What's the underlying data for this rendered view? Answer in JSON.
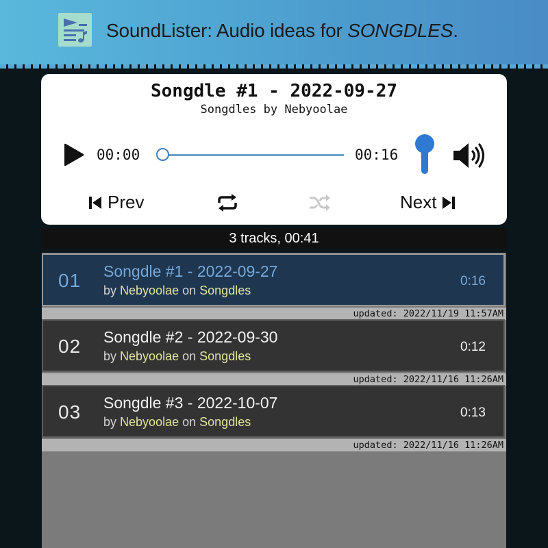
{
  "header": {
    "title_prefix": "SoundLister: Audio ideas for ",
    "title_emphasis": "SONGDLES",
    "title_suffix": ".",
    "logo_icon": "playlist-music-icon",
    "colors": {
      "gradient_start": "#5ab8dc",
      "gradient_end": "#4a8cc6",
      "logo_bg": "#a6dccb"
    }
  },
  "player": {
    "now_playing_title": "Songdle #1 - 2022-09-27",
    "now_playing_subtitle": "Songdles by Nebyoolae",
    "current_time": "00:00",
    "duration": "00:16",
    "progress": 0,
    "volume": 1.0,
    "icons": {
      "play": "play-icon",
      "volume": "volume-icon",
      "prev": "skip-back-icon",
      "repeat": "repeat-icon",
      "shuffle": "shuffle-icon",
      "next": "skip-forward-icon"
    },
    "prev_label": "Prev",
    "next_label": "Next",
    "shuffle_enabled": false,
    "accent_color": "#2f79d2"
  },
  "summary": {
    "text": "3 tracks, 00:41"
  },
  "tracks": [
    {
      "number": "01",
      "title": "Songdle #1 - 2022-09-27",
      "by_prefix": "by",
      "artist": "Nebyoolae",
      "on_word": "on",
      "album": "Songdles",
      "duration": "0:16",
      "updated": "updated: 2022/11/19 11:57AM",
      "active": true
    },
    {
      "number": "02",
      "title": "Songdle #2 - 2022-09-30",
      "by_prefix": "by",
      "artist": "Nebyoolae",
      "on_word": "on",
      "album": "Songdles",
      "duration": "0:12",
      "updated": "updated: 2022/11/16 11:26AM",
      "active": false
    },
    {
      "number": "03",
      "title": "Songdle #3 - 2022-10-07",
      "by_prefix": "by",
      "artist": "Nebyoolae",
      "on_word": "on",
      "album": "Songdles",
      "duration": "0:13",
      "updated": "updated: 2022/11/16 11:26AM",
      "active": false
    }
  ],
  "colors": {
    "active_row_bg": "#1e3650",
    "active_row_text": "#76a8d8",
    "row_bg": "#333333",
    "highlight_text": "#e0e49c",
    "list_bg": "#7b7b7b"
  }
}
